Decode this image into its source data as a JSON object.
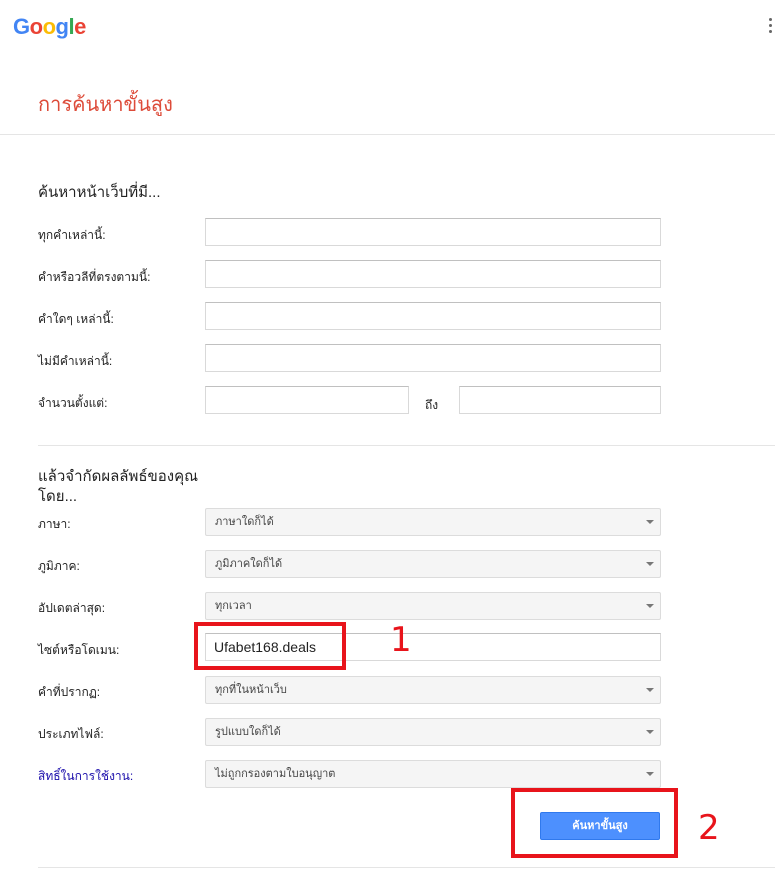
{
  "logo": {
    "letters": [
      "G",
      "o",
      "o",
      "g",
      "l",
      "e"
    ],
    "colors": [
      "#4285f4",
      "#ea4335",
      "#fbbc05",
      "#4285f4",
      "#34a853",
      "#ea4335"
    ]
  },
  "header": {
    "menu_icon": "more-vert-icon"
  },
  "page_title": "การค้นหาขั้นสูง",
  "find_pages": {
    "title": "ค้นหาหน้าเว็บที่มี...",
    "fields": [
      {
        "label": "ทุกคำเหล่านี้:",
        "value": ""
      },
      {
        "label": "คำหรือวลีที่ตรงตามนี้:",
        "value": ""
      },
      {
        "label": "คำใดๆ เหล่านี้:",
        "value": ""
      },
      {
        "label": "ไม่มีคำเหล่านี้:",
        "value": ""
      }
    ],
    "range": {
      "label": "จำนวนตั้งแต่:",
      "to_label": "ถึง",
      "from_value": "",
      "to_value": ""
    }
  },
  "narrow": {
    "title_line1": "แล้วจำกัดผลลัพธ์ของคุณ",
    "title_line2": "โดย...",
    "language": {
      "label": "ภาษา:",
      "value": "ภาษาใดก็ได้"
    },
    "region": {
      "label": "ภูมิภาค:",
      "value": "ภูมิภาคใดก็ได้"
    },
    "last_update": {
      "label": "อัปเดตล่าสุด:",
      "value": "ทุกเวลา"
    },
    "site": {
      "label": "ไซต์หรือโดเมน:",
      "value": "Ufabet168.deals"
    },
    "terms_appearing": {
      "label": "คำที่ปรากฏ:",
      "value": "ทุกที่ในหน้าเว็บ"
    },
    "file_type": {
      "label": "ประเภทไฟล์:",
      "value": "รูปแบบใดก็ได้"
    },
    "usage_rights": {
      "label": "สิทธิ์ในการใช้งาน:",
      "value": "ไม่ถูกกรองตามใบอนุญาต"
    }
  },
  "submit_label": "ค้นหาขั้นสูง",
  "annotations": {
    "first": "1",
    "second": "2",
    "color": "#e8141b"
  }
}
